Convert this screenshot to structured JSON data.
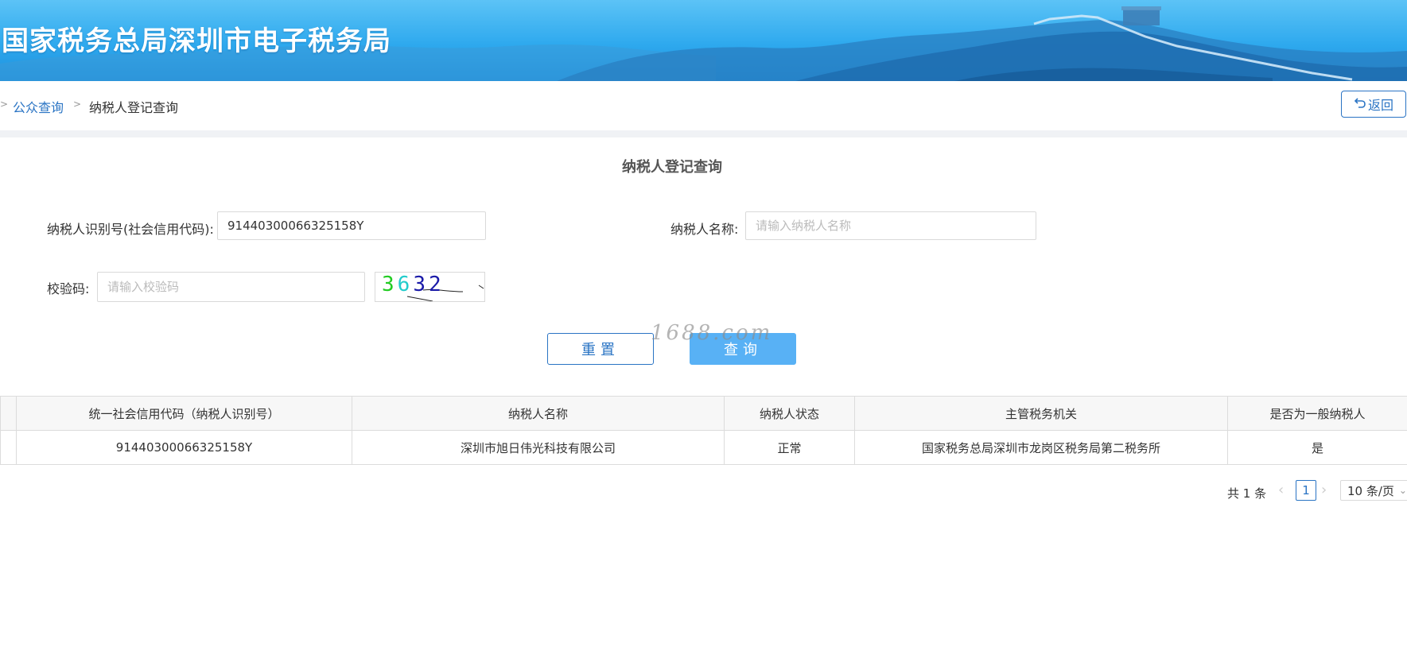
{
  "header": {
    "site_title": "国家税务总局深圳市电子税务局"
  },
  "breadcrumb": {
    "lead": ">",
    "link": "公众查询",
    "separator": ">",
    "current": "纳税人登记查询"
  },
  "back_button": {
    "icon": "undo-icon",
    "label": "返回"
  },
  "form": {
    "title": "纳税人登记查询",
    "taxpayer_id_label": "纳税人识别号(社会信用代码):",
    "taxpayer_id_value": "91440300066325158Y",
    "taxpayer_name_label": "纳税人名称:",
    "taxpayer_name_placeholder": "请输入纳税人名称",
    "captcha_label": "校验码:",
    "captcha_placeholder": "请输入校验码",
    "captcha_digits": [
      "3",
      "6",
      "3",
      "2"
    ],
    "captcha_colors": [
      "#22cc22",
      "#22cccc",
      "#1a1aa8",
      "#1a1aa8"
    ],
    "reset_label": "重置",
    "query_label": "查询"
  },
  "watermark": "1688.com",
  "table": {
    "columns": [
      "统一社会信用代码（纳税人识别号）",
      "纳税人名称",
      "纳税人状态",
      "主管税务机关",
      "是否为一般纳税人"
    ],
    "rows": [
      [
        "91440300066325158Y",
        "深圳市旭日伟光科技有限公司",
        "正常",
        "国家税务总局深圳市龙岗区税务局第二税务所",
        "是"
      ]
    ]
  },
  "pagination": {
    "total": "共 1 条",
    "current_page": "1",
    "page_size": "10 条/页"
  },
  "colors": {
    "banner": "#2ea9ee",
    "link": "#2a74c4",
    "primary_button": "#58b1f5"
  }
}
